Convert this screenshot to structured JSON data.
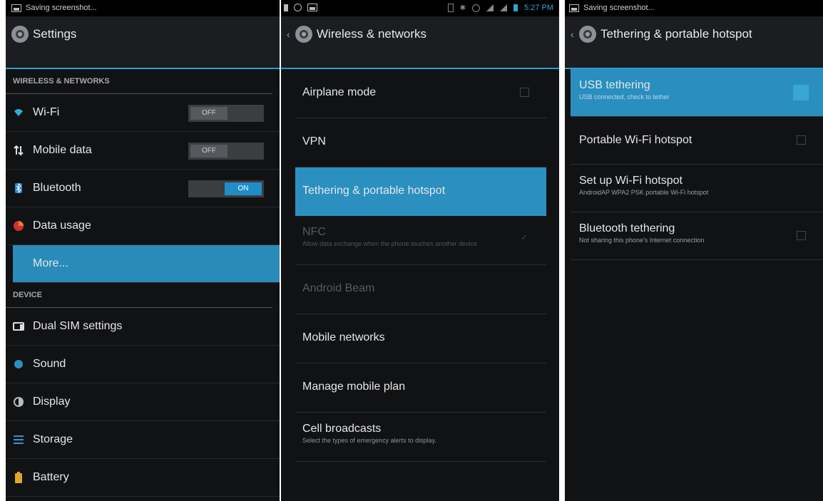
{
  "panel1": {
    "status": "Saving screenshot...",
    "title": "Settings",
    "headers": {
      "wireless": "WIRELESS & NETWORKS",
      "device": "DEVICE"
    },
    "wireless_items": [
      {
        "label": "Wi-Fi",
        "icon": "wifi-icon",
        "toggle": "OFF"
      },
      {
        "label": "Mobile data",
        "icon": "mobile-data-icon",
        "toggle": "OFF"
      },
      {
        "label": "Bluetooth",
        "icon": "bluetooth-icon",
        "toggle": "ON"
      },
      {
        "label": "Data usage",
        "icon": "data-usage-icon"
      },
      {
        "label": "More...",
        "icon": "",
        "selected": true
      }
    ],
    "device_items": [
      {
        "label": "Dual SIM settings",
        "icon": "dual-sim-icon"
      },
      {
        "label": "Sound",
        "icon": "sound-icon"
      },
      {
        "label": "Display",
        "icon": "display-icon"
      },
      {
        "label": "Storage",
        "icon": "storage-icon"
      },
      {
        "label": "Battery",
        "icon": "battery-icon"
      }
    ]
  },
  "panel2": {
    "time": "5:27 PM",
    "title": "Wireless & networks",
    "items": [
      {
        "title": "Airplane mode",
        "checkbox": "unchecked"
      },
      {
        "title": "VPN"
      },
      {
        "title": "Tethering & portable hotspot",
        "selected": true
      },
      {
        "title": "NFC",
        "subtitle": "Allow data exchange when the phone touches another device",
        "checkbox": "checked",
        "disabled": true
      },
      {
        "title": "Android Beam",
        "disabled": true
      },
      {
        "title": "Mobile networks"
      },
      {
        "title": "Manage mobile plan"
      },
      {
        "title": "Cell broadcasts",
        "subtitle": "Select the types of emergency alerts to display."
      }
    ]
  },
  "panel3": {
    "status": "Saving screenshot...",
    "title": "Tethering & portable hotspot",
    "items": [
      {
        "title": "USB tethering",
        "subtitle": "USB connected, check to tether",
        "checkbox": "on",
        "selected": true
      },
      {
        "title": "Portable Wi-Fi hotspot",
        "checkbox": "unchecked"
      },
      {
        "title": "Set up Wi-Fi hotspot",
        "subtitle": "AndroidAP WPA2 PSK portable Wi-Fi hotspot"
      },
      {
        "title": "Bluetooth tethering",
        "subtitle": "Not sharing this phone's Internet connection",
        "checkbox": "unchecked"
      }
    ]
  },
  "colors": {
    "accent": "#2b90c0",
    "background": "#111214",
    "actionbar": "#1c1d20"
  }
}
